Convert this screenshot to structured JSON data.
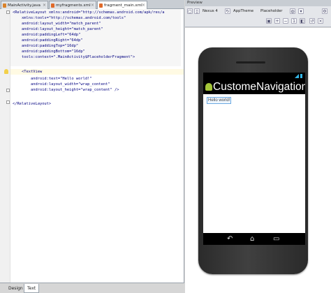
{
  "tabs": [
    {
      "label": "MainActivity.java",
      "active": false
    },
    {
      "label": "myfragments.xml",
      "active": false
    },
    {
      "label": "fragment_main.xml",
      "active": true
    }
  ],
  "code": [
    "<RelativeLayout xmlns:android=\"http://schemas.android.com/apk/res/a",
    "    xmlns:tools=\"http://schemas.android.com/tools\"",
    "    android:layout_width=\"match_parent\"",
    "    android:layout_height=\"match_parent\"",
    "    android:paddingLeft=\"64dp\"",
    "    android:paddingRight=\"64dp\"",
    "    android:paddingTop=\"16dp\"",
    "    android:paddingBottom=\"16dp\"",
    "    tools:context=\".MainActivity$PlaceholderFragment\">",
    "",
    "    <TextView",
    "        android:text=\"Hello world!\"",
    "        android:layout_width=\"wrap_content\"",
    "        android:layout_height=\"wrap_content\" />",
    "",
    "</RelativeLayout>"
  ],
  "bottom_tabs": [
    {
      "label": "Design",
      "active": false
    },
    {
      "label": "Text",
      "active": true
    }
  ],
  "preview": {
    "title": "Preview",
    "device": "Nexus 4",
    "theme": "AppTheme",
    "activity": "Placeholder"
  },
  "phone": {
    "app_title": "CustomeNavigationD",
    "content_text": "Hello world!"
  },
  "colors": {
    "holo_blue": "#33b5e5",
    "android_green": "#a4c639"
  }
}
